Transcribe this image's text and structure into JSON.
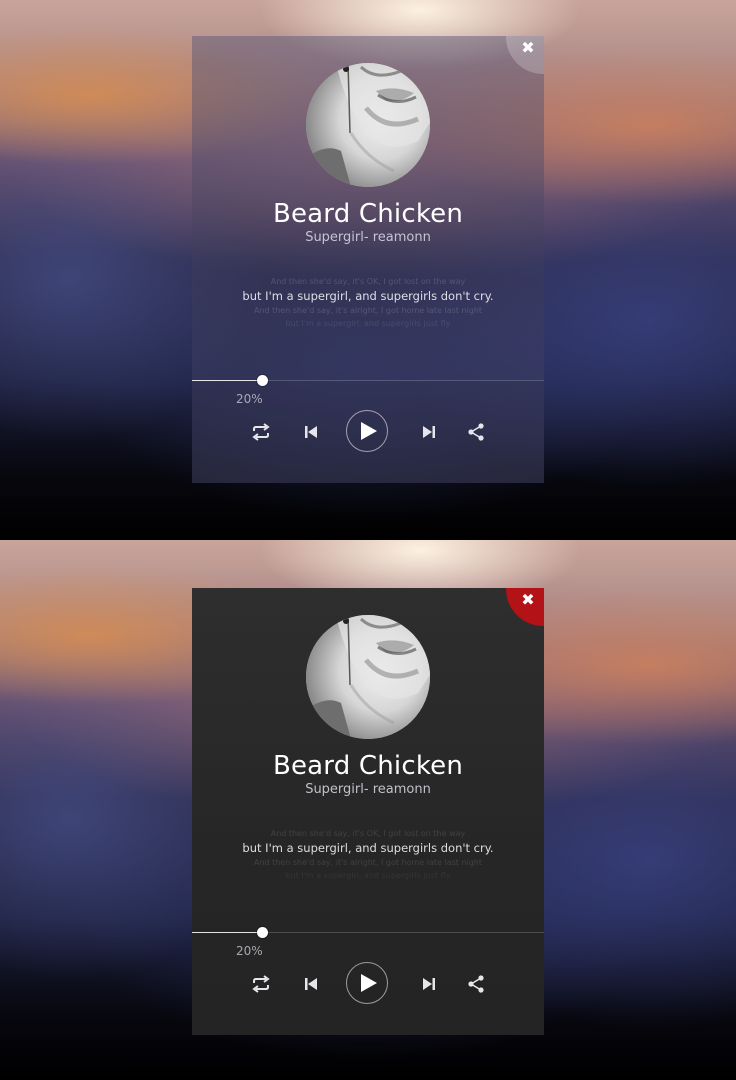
{
  "song": {
    "title": "Beard Chicken",
    "artist": "Supergirl- reamonn"
  },
  "lyrics": {
    "previous_1": "And then she'd say, it's OK, I got lost on the way",
    "current": "but I'm a supergirl, and supergirls don't cry.",
    "next_1": "And then she'd say, it's alright, I got home late last night",
    "next_2": "but I'm a supergirl, and supergirls just fly"
  },
  "progress": {
    "value": 0.2,
    "label": "20%"
  },
  "controls": {
    "repeat": "repeat-icon",
    "previous": "skip-previous-icon",
    "play": "play-icon",
    "next": "skip-next-icon",
    "share": "share-icon",
    "close": "close-icon",
    "close_glyph": "✖"
  },
  "variants": [
    {
      "name": "glass",
      "close_color": "#ffffff"
    },
    {
      "name": "dark",
      "close_color": "#b31217"
    }
  ]
}
